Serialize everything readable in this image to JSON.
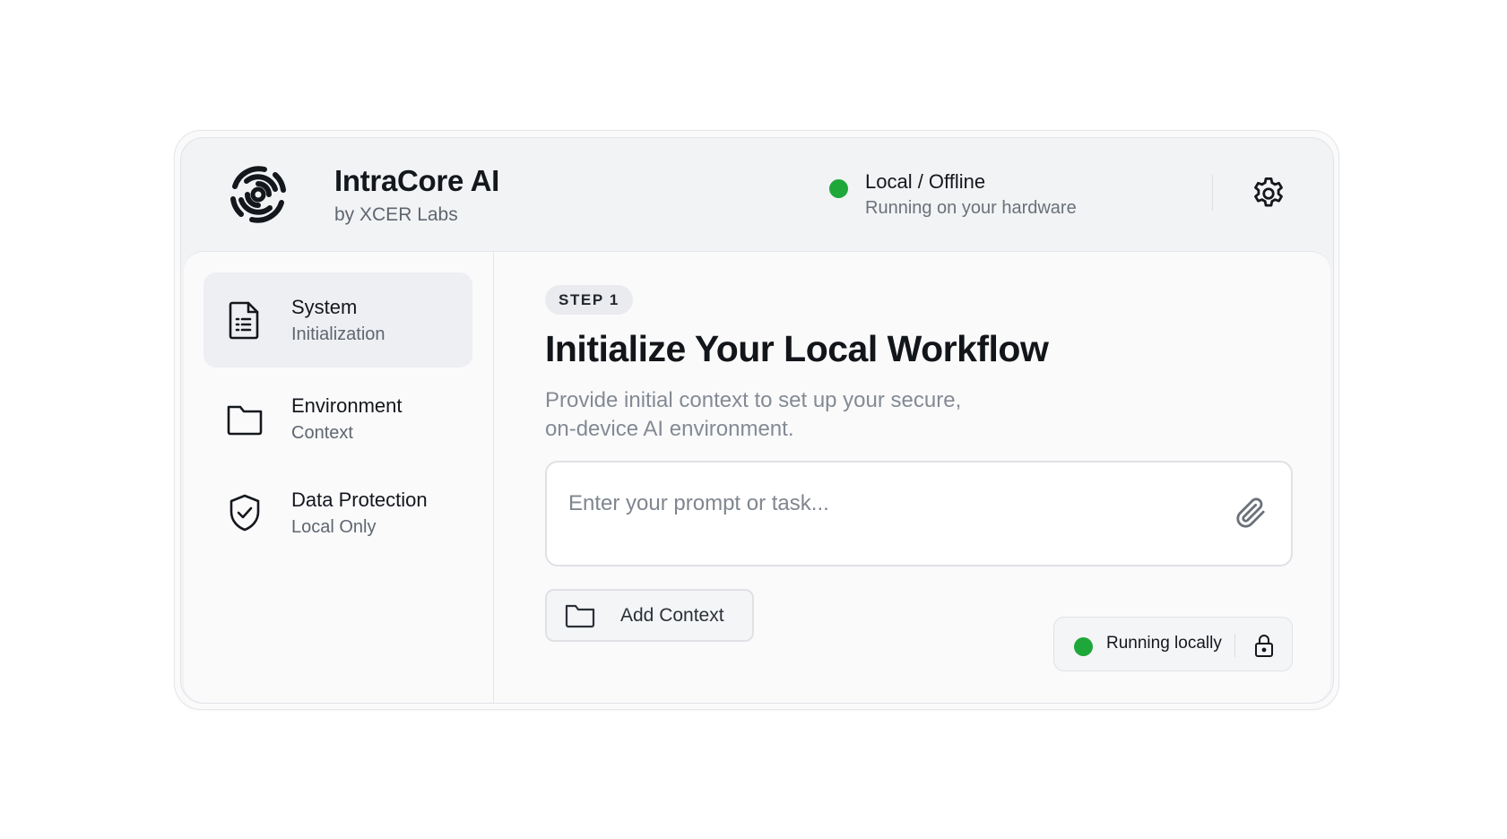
{
  "header": {
    "title": "IntraCore AI",
    "subtitle": "by XCER Labs",
    "logo_icon": "spiral-logo-icon",
    "status": {
      "title": "Local / Offline",
      "subtitle": "Running on your hardware",
      "color": "#1fa83a"
    },
    "settings_icon": "gear-icon"
  },
  "sidebar": {
    "items": [
      {
        "title": "System",
        "subtitle": "Initialization",
        "icon": "document-icon",
        "active": true
      },
      {
        "title": "Environment",
        "subtitle": "Context",
        "icon": "folder-icon",
        "active": false
      },
      {
        "title": "Data Protection",
        "subtitle": "Local Only",
        "icon": "shield-check-icon",
        "active": false
      }
    ]
  },
  "main": {
    "step_label": "STEP 1",
    "title": "Initialize Your Local Workflow",
    "description_line1": "Provide initial context to set up your secure,",
    "description_line2": "on-device AI environment.",
    "prompt": {
      "value": "",
      "placeholder": "Enter your prompt or task...",
      "attach_icon": "paperclip-icon"
    },
    "add_context": {
      "label": "Add Context",
      "icon": "folder-icon"
    },
    "run_status": {
      "label": "Running locally",
      "icon": "lock-icon",
      "color": "#1fa83a"
    }
  }
}
